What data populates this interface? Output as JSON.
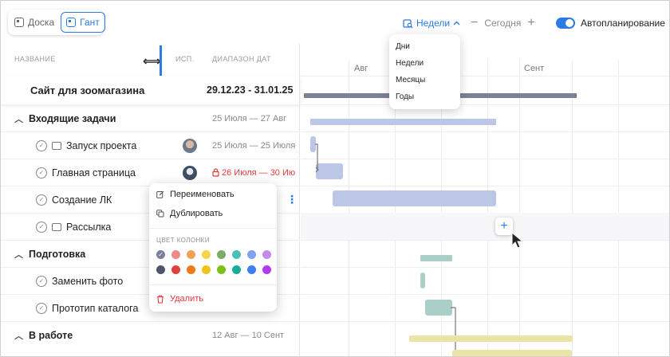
{
  "view_switch": {
    "board_label": "Доска",
    "gantt_label": "Гант",
    "active": "gantt"
  },
  "toolbar": {
    "scale_label": "Недели",
    "today_label": "Сегодня",
    "minus": "−",
    "plus": "+",
    "autoplanning_label": "Автопланирование",
    "autoplanning_on": true
  },
  "scale_dropdown": {
    "options": [
      "Дни",
      "Недели",
      "Месяцы",
      "Годы"
    ]
  },
  "columns": {
    "name": "НАЗВАНИЕ",
    "assignee": "ИСП.",
    "date_range": "ДИАПАЗОН ДАТ"
  },
  "project": {
    "name": "Сайт для зоомагазина",
    "dates": "29.12.23 - 31.01.25"
  },
  "rows": [
    {
      "type": "group",
      "name": "Входящие задачи",
      "dates": "25 Июля — 27 Авг"
    },
    {
      "type": "task",
      "name": "Запуск проекта",
      "dates": "25 Июля — 25 Июля",
      "icon": "folder"
    },
    {
      "type": "task",
      "name": "Главная страница",
      "dates": "26 Июля — 30 Ию",
      "overdue": true,
      "icon": ""
    },
    {
      "type": "task",
      "name": "Создание ЛК",
      "dates": "",
      "icon": ""
    },
    {
      "type": "task",
      "name": "Рассылка",
      "dates": "",
      "icon": "folder"
    },
    {
      "type": "group",
      "name": "Подготовка",
      "dates": ""
    },
    {
      "type": "task",
      "name": "Заменить фото",
      "dates": "",
      "icon": ""
    },
    {
      "type": "task",
      "name": "Прототип каталога",
      "dates": "",
      "icon": ""
    },
    {
      "type": "group",
      "name": "В работе",
      "dates": "12 Авг — 10 Сент"
    }
  ],
  "timeline": {
    "months": [
      "Авг",
      "Сент"
    ]
  },
  "context_menu": {
    "rename": "Переименовать",
    "duplicate": "Дублировать",
    "color_label": "ЦВЕТ КОЛОНКИ",
    "delete": "Удалить",
    "colors_row1": [
      "#7a8197",
      "#f08a8a",
      "#f0a05a",
      "#f5d54a",
      "#7cab6a",
      "#4cc0b5",
      "#7fa3f0",
      "#c58af0"
    ],
    "colors_row2": [
      "#4f5669",
      "#e0413a",
      "#f07a1a",
      "#f0c21a",
      "#7ac21a",
      "#1aab9a",
      "#3a7ef0",
      "#b23af0"
    ],
    "selected_color": "#7a8197"
  },
  "colors": {
    "accent": "#2a7be4",
    "project_bar": "#7c8296",
    "group1_bar": "#bcc7e8",
    "group2_bar": "#a9cfc8",
    "group3_bar": "#ece3a6",
    "danger": "#e03b3b"
  }
}
